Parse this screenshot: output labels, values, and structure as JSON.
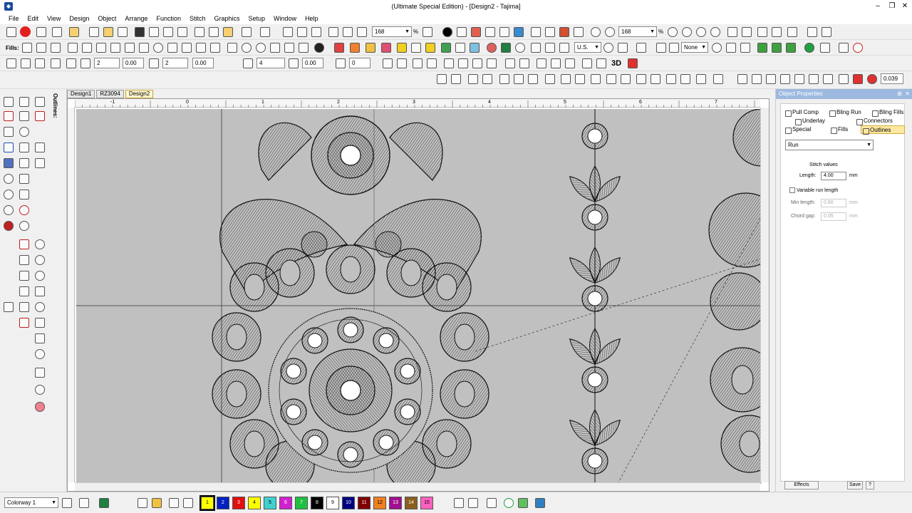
{
  "window": {
    "title": "(Ultimate Special Edition) - [Design2 - Tajima]",
    "minimize": "–",
    "restore": "❐",
    "close": "✕"
  },
  "menu": [
    "File",
    "Edit",
    "View",
    "Design",
    "Object",
    "Arrange",
    "Function",
    "Stitch",
    "Graphics",
    "Setup",
    "Window",
    "Help"
  ],
  "toolbar1": {
    "zoom_left": "168",
    "zoom_right": "168",
    "percent": "%"
  },
  "toolbar2": {
    "fills_label": "Fills:",
    "unit": "U.S.",
    "none_option": "None"
  },
  "toolbar3": {
    "val1": "0.00",
    "val2": "0.00",
    "val3": "4",
    "val4": "0.00",
    "val5": "0",
    "label_3d": "3D"
  },
  "toolbar4": {
    "scale_value": "0.039"
  },
  "tabs": [
    "Design1",
    "RZ3094",
    "Design2"
  ],
  "left_panel": {
    "outlines_label": "Outlines:"
  },
  "ruler": {
    "labels": [
      "-1",
      "0",
      "1",
      "2",
      "3",
      "4",
      "5",
      "6",
      "7"
    ]
  },
  "properties": {
    "title": "Object Properties",
    "tabs": [
      "Pull Comp",
      "Bling Run",
      "Bling Fills",
      "Underlay",
      "Connectors",
      "Special",
      "Fills",
      "Outlines"
    ],
    "run_type": "Run",
    "stitch_values": "Stitch values",
    "length_label": "Length:",
    "length_value": "4.00",
    "length_unit": "mm",
    "variable_label": "Variable run length",
    "min_length_label": "Min length:",
    "min_length_value": "0.80",
    "min_unit": "mm",
    "chord_gap_label": "Chord gap:",
    "chord_gap_value": "0.05",
    "chord_unit": "mm",
    "effects_button": "Effects",
    "save_button": "Save",
    "help_button": "?"
  },
  "status": {
    "colorway": "Colorway 1",
    "swatches": [
      {
        "label": "1",
        "color": "#ffff00"
      },
      {
        "label": "2",
        "color": "#0020c0"
      },
      {
        "label": "3",
        "color": "#e01010"
      },
      {
        "label": "4",
        "color": "#ffff00"
      },
      {
        "label": "5",
        "color": "#40d0d0"
      },
      {
        "label": "6",
        "color": "#d020d0"
      },
      {
        "label": "7",
        "color": "#20c040"
      },
      {
        "label": "8",
        "color": "#000000"
      },
      {
        "label": "9",
        "color": "#ffffff"
      },
      {
        "label": "10",
        "color": "#000080"
      },
      {
        "label": "11",
        "color": "#800000"
      },
      {
        "label": "12",
        "color": "#f08020"
      },
      {
        "label": "13",
        "color": "#a01090"
      },
      {
        "label": "14",
        "color": "#8a6020"
      },
      {
        "label": "15",
        "color": "#ff60c0"
      }
    ]
  }
}
